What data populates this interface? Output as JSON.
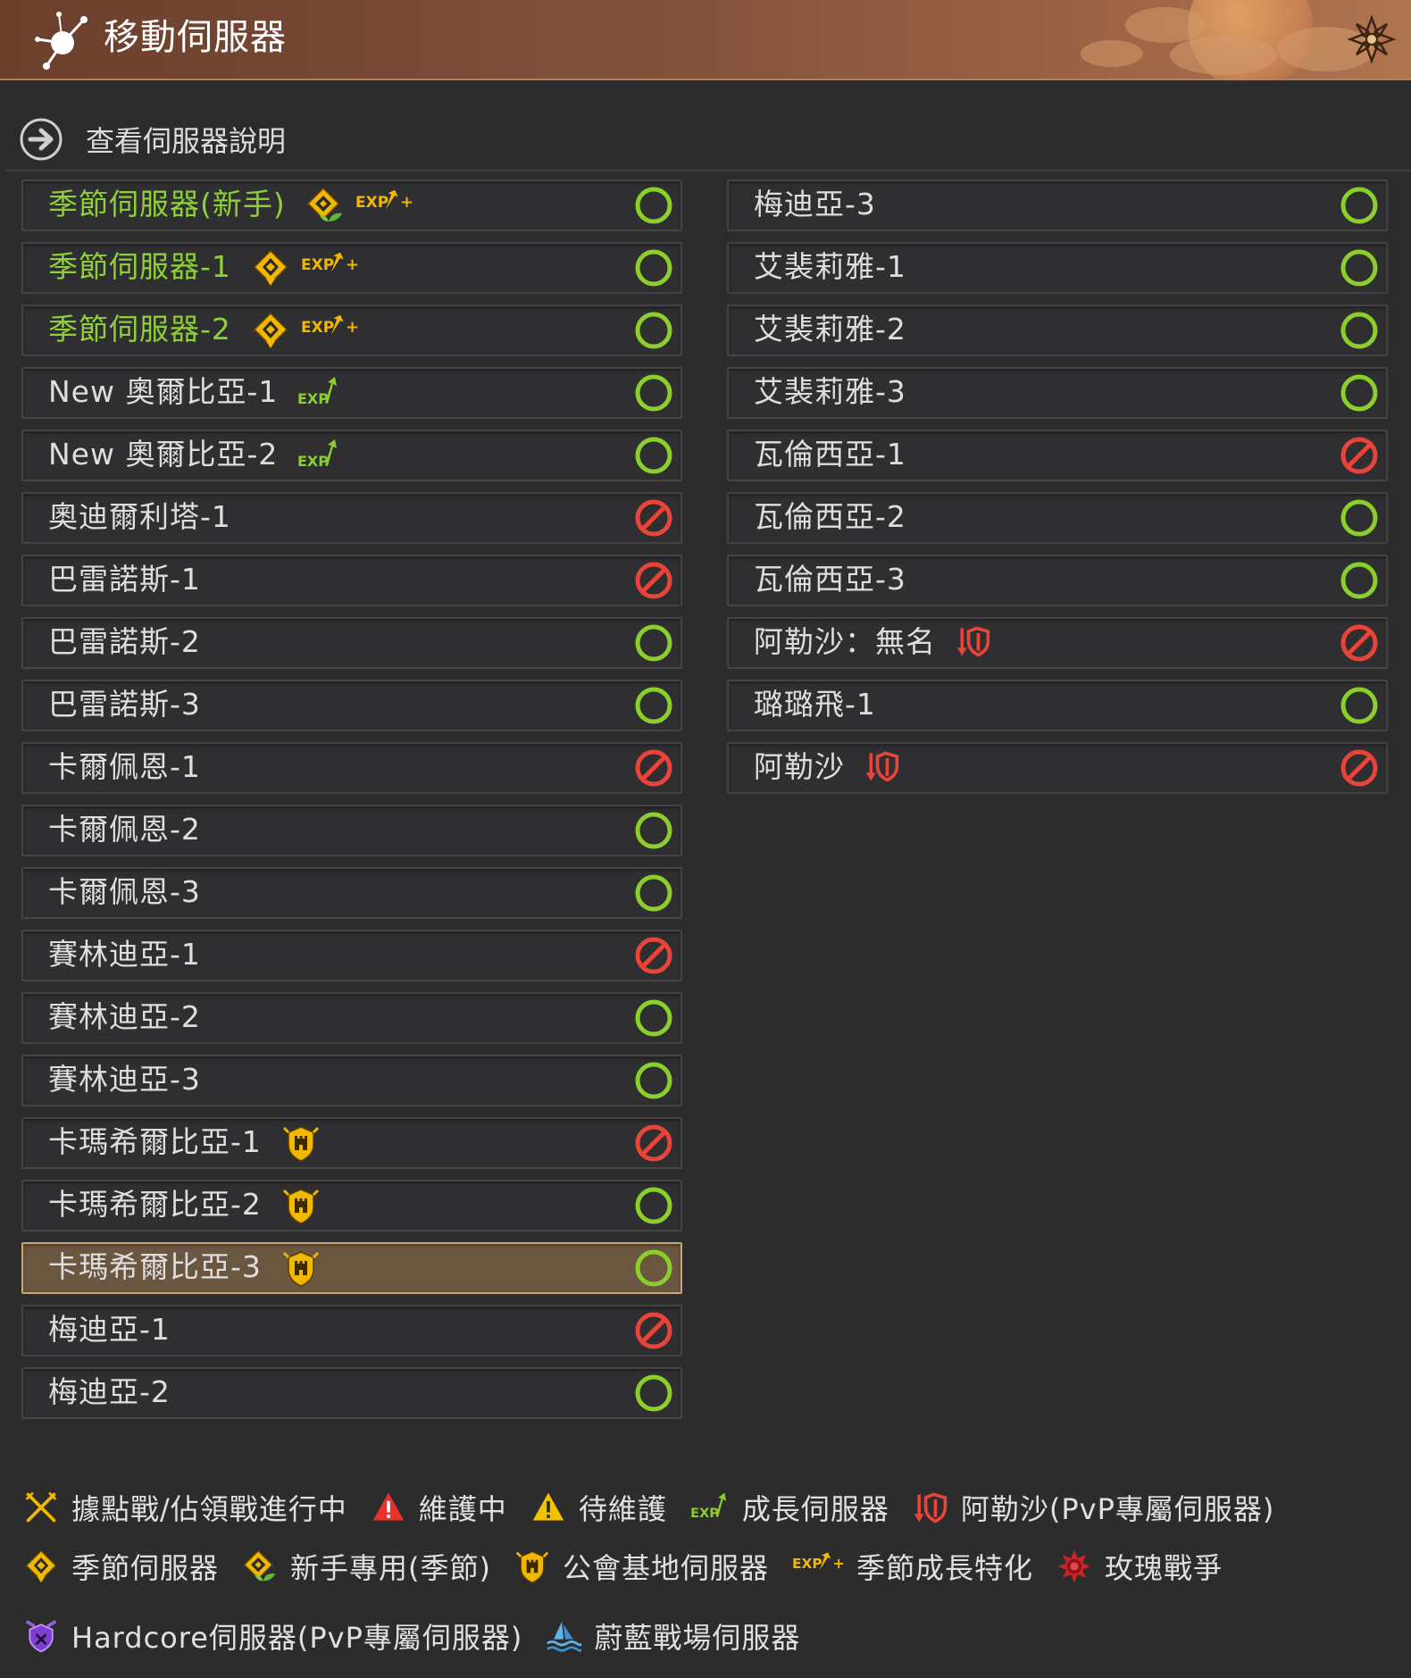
{
  "window": {
    "title": "移動伺服器",
    "logo_icon": "compass-star-icon",
    "close_icon": "flower-close-icon"
  },
  "help": {
    "label": "查看伺服器說明",
    "icon": "arrow-right-circle-icon"
  },
  "badges": {
    "exp_plus": "EXP",
    "exp": "EXP",
    "plus": "+"
  },
  "colors": {
    "online": "#8bcf2c",
    "blocked": "#e8443a",
    "server_name_green": "#8fcf3a",
    "badge_gold": "#f2b800",
    "selected_bg": "#6b5640"
  },
  "servers_left": [
    {
      "name": "季節伺服器(新手)",
      "green": true,
      "badges": [
        "seasonal-newbie-icon",
        "exp-plus-badge"
      ],
      "status": "ok"
    },
    {
      "name": "季節伺服器-1",
      "green": true,
      "badges": [
        "seasonal-icon",
        "exp-plus-badge"
      ],
      "status": "ok"
    },
    {
      "name": "季節伺服器-2",
      "green": true,
      "badges": [
        "seasonal-icon",
        "exp-plus-badge"
      ],
      "status": "ok"
    },
    {
      "name": "New 奧爾比亞-1",
      "green": false,
      "badges": [
        "exp-badge"
      ],
      "status": "ok"
    },
    {
      "name": "New 奧爾比亞-2",
      "green": false,
      "badges": [
        "exp-badge"
      ],
      "status": "ok"
    },
    {
      "name": "奧迪爾利塔-1",
      "green": false,
      "badges": [],
      "status": "blocked"
    },
    {
      "name": "巴雷諾斯-1",
      "green": false,
      "badges": [],
      "status": "blocked"
    },
    {
      "name": "巴雷諾斯-2",
      "green": false,
      "badges": [],
      "status": "ok"
    },
    {
      "name": "巴雷諾斯-3",
      "green": false,
      "badges": [],
      "status": "ok"
    },
    {
      "name": "卡爾佩恩-1",
      "green": false,
      "badges": [],
      "status": "blocked"
    },
    {
      "name": "卡爾佩恩-2",
      "green": false,
      "badges": [],
      "status": "ok"
    },
    {
      "name": "卡爾佩恩-3",
      "green": false,
      "badges": [],
      "status": "ok"
    },
    {
      "name": "賽林迪亞-1",
      "green": false,
      "badges": [],
      "status": "blocked"
    },
    {
      "name": "賽林迪亞-2",
      "green": false,
      "badges": [],
      "status": "ok"
    },
    {
      "name": "賽林迪亞-3",
      "green": false,
      "badges": [],
      "status": "ok"
    },
    {
      "name": "卡瑪希爾比亞-1",
      "green": false,
      "badges": [
        "guild-base-icon"
      ],
      "status": "blocked"
    },
    {
      "name": "卡瑪希爾比亞-2",
      "green": false,
      "badges": [
        "guild-base-icon"
      ],
      "status": "ok"
    },
    {
      "name": "卡瑪希爾比亞-3",
      "green": false,
      "badges": [
        "guild-base-icon"
      ],
      "status": "ok",
      "selected": true
    },
    {
      "name": "梅迪亞-1",
      "green": false,
      "badges": [],
      "status": "blocked"
    },
    {
      "name": "梅迪亞-2",
      "green": false,
      "badges": [],
      "status": "ok"
    }
  ],
  "servers_right": [
    {
      "name": "梅迪亞-3",
      "green": false,
      "badges": [],
      "status": "ok"
    },
    {
      "name": "艾裴莉雅-1",
      "green": false,
      "badges": [],
      "status": "ok"
    },
    {
      "name": "艾裴莉雅-2",
      "green": false,
      "badges": [],
      "status": "ok"
    },
    {
      "name": "艾裴莉雅-3",
      "green": false,
      "badges": [],
      "status": "ok"
    },
    {
      "name": "瓦倫西亞-1",
      "green": false,
      "badges": [],
      "status": "blocked"
    },
    {
      "name": "瓦倫西亞-2",
      "green": false,
      "badges": [],
      "status": "ok"
    },
    {
      "name": "瓦倫西亞-3",
      "green": false,
      "badges": [],
      "status": "ok"
    },
    {
      "name": "阿勒沙：無名",
      "green": false,
      "badges": [
        "arsha-pvp-icon"
      ],
      "status": "blocked"
    },
    {
      "name": "璐璐飛-1",
      "green": false,
      "badges": [],
      "status": "ok"
    },
    {
      "name": "阿勒沙",
      "green": false,
      "badges": [
        "arsha-pvp-icon"
      ],
      "status": "blocked"
    }
  ],
  "legend": [
    [
      {
        "icon": "crossed-swords-icon",
        "label": "據點戰/佔領戰進行中"
      },
      {
        "icon": "maintenance-red-warning-icon",
        "label": "維護中"
      },
      {
        "icon": "pending-yellow-warning-icon",
        "label": "待維護"
      },
      {
        "icon": "exp-badge",
        "label": "成長伺服器"
      },
      {
        "icon": "arsha-pvp-icon",
        "label": "阿勒沙(PvP專屬伺服器)"
      }
    ],
    [
      {
        "icon": "seasonal-icon",
        "label": "季節伺服器"
      },
      {
        "icon": "seasonal-newbie-icon",
        "label": "新手專用(季節)"
      },
      {
        "icon": "guild-base-icon",
        "label": "公會基地伺服器"
      },
      {
        "icon": "exp-plus-badge",
        "label": "季節成長特化"
      },
      {
        "icon": "rose-war-icon",
        "label": "玫瑰戰爭"
      }
    ],
    [
      {
        "icon": "hardcore-shield-icon",
        "label": "Hardcore伺服器(PvP專屬伺服器)"
      },
      {
        "icon": "azure-arena-icon",
        "label": "蔚藍戰場伺服器"
      }
    ]
  ]
}
